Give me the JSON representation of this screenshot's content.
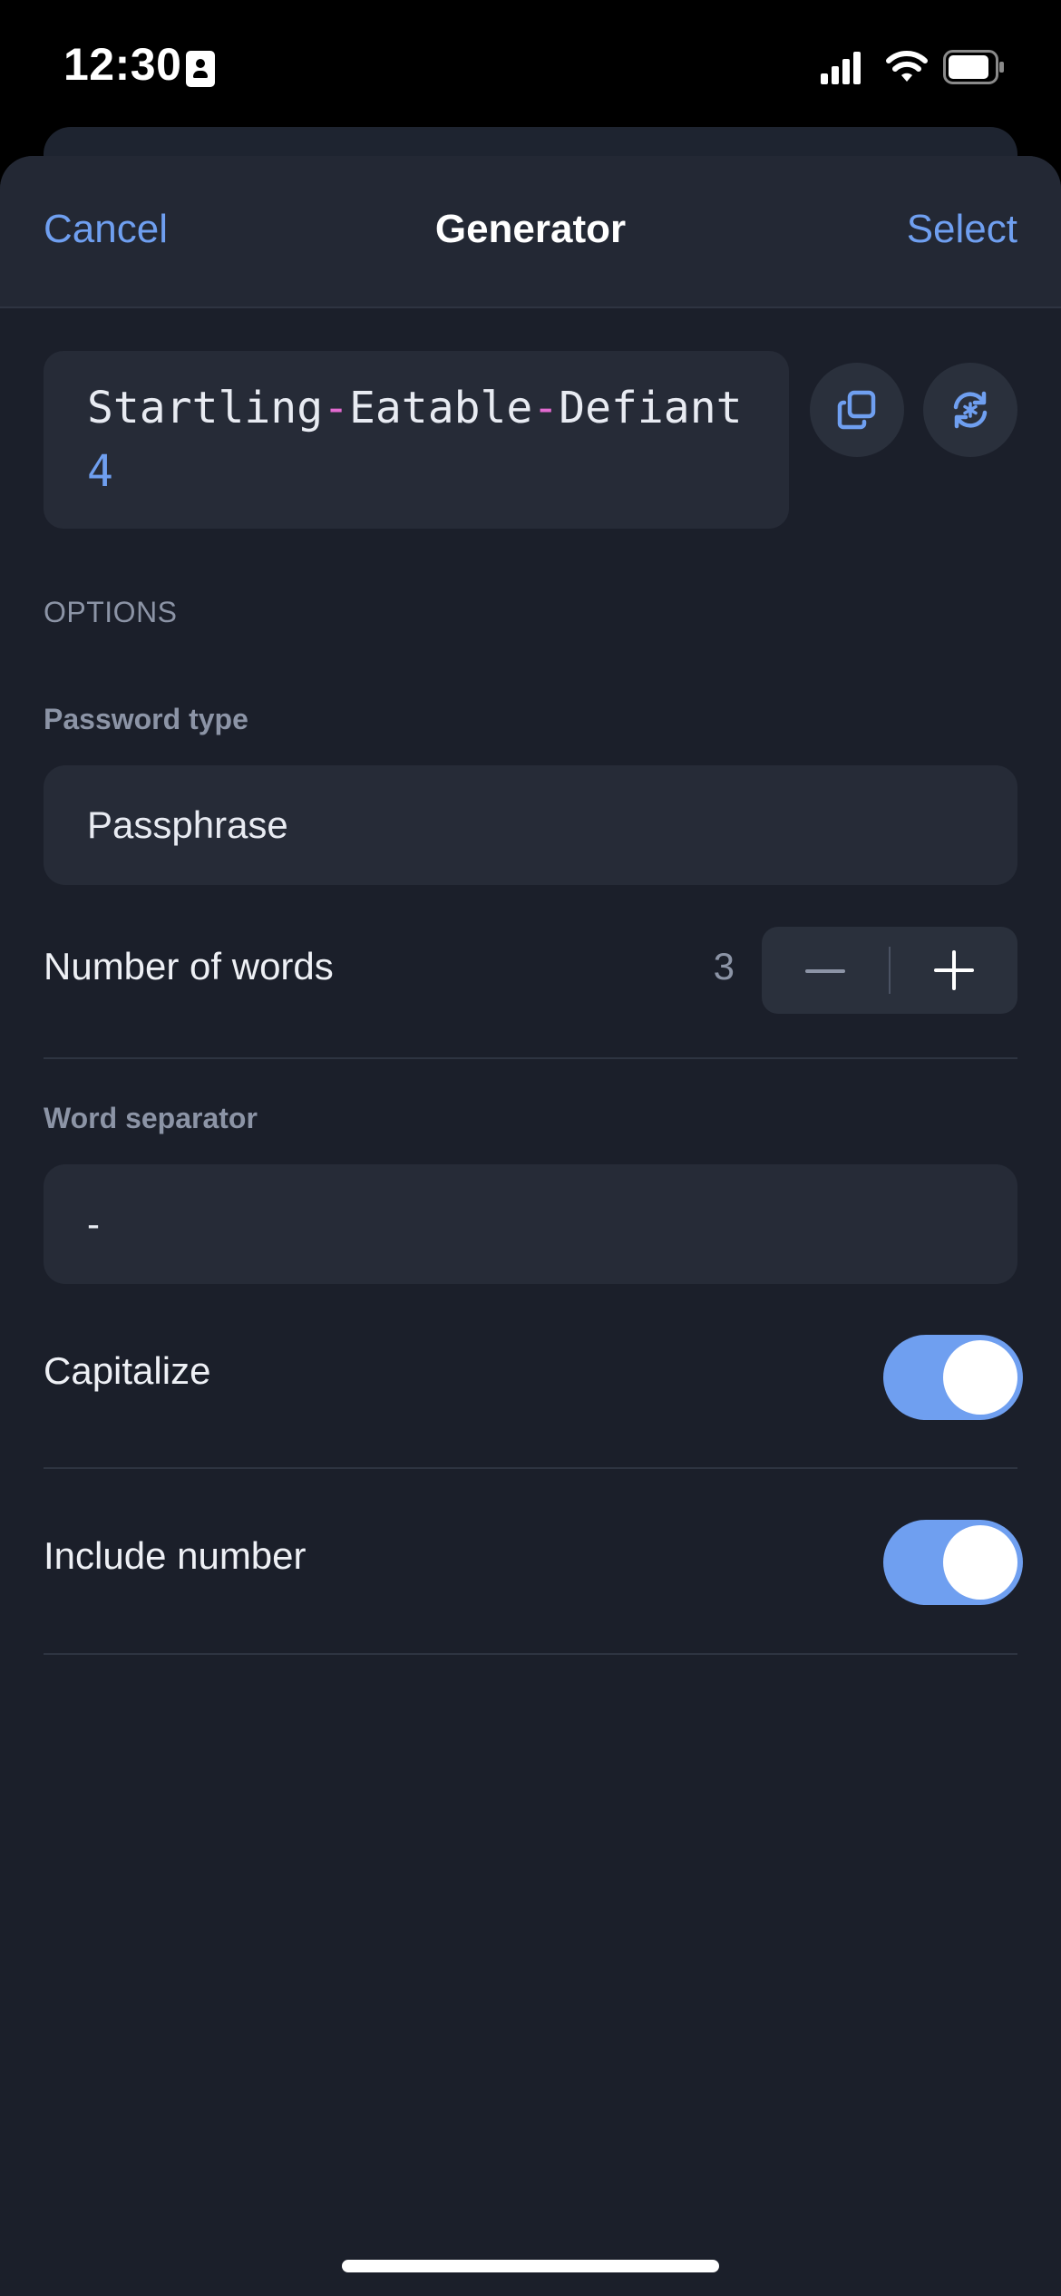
{
  "status_bar": {
    "time": "12:30"
  },
  "nav": {
    "cancel_label": "Cancel",
    "title": "Generator",
    "select_label": "Select"
  },
  "generated_password": {
    "parts": [
      {
        "text": "Startling",
        "kind": "word"
      },
      {
        "text": "-",
        "kind": "separator"
      },
      {
        "text": "Eatable",
        "kind": "word"
      },
      {
        "text": "-",
        "kind": "separator"
      },
      {
        "text": "Defiant",
        "kind": "word"
      },
      {
        "text": "4",
        "kind": "number"
      }
    ]
  },
  "options": {
    "header": "OPTIONS",
    "password_type_label": "Password type",
    "password_type_value": "Passphrase",
    "number_of_words_label": "Number of words",
    "number_of_words_value": "3",
    "word_separator_label": "Word separator",
    "word_separator_value": "-",
    "capitalize_label": "Capitalize",
    "capitalize_on": true,
    "include_number_label": "Include number",
    "include_number_on": true
  },
  "icons": {
    "copy": "copy-icon",
    "regenerate": "regenerate-icon"
  },
  "colors": {
    "accent": "#6f9ff0",
    "separator_highlight": "#e26ad0",
    "background": "#1b1f2a",
    "surface": "#262b37"
  }
}
